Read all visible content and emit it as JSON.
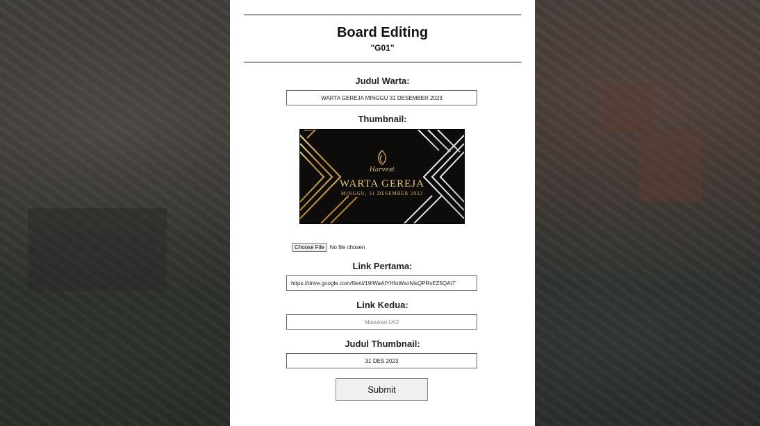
{
  "header": {
    "title": "Board Editing",
    "subtitle": "\"G01\""
  },
  "form": {
    "judul_warta": {
      "label": "Judul Warta:",
      "value": "WARTA GEREJA MINGGU 31 DESEMBER 2023"
    },
    "thumbnail": {
      "label": "Thumbnail:",
      "image": {
        "script_text": "Harvest",
        "headline": "WARTA GEREJA",
        "date_line": "MINGGU, 31 DESEMBER 2023"
      },
      "file_button": "Choose File",
      "file_status": "No file chosen"
    },
    "link_pertama": {
      "label": "Link Pertama:",
      "value": "https://drive.google.com/file/d/19IWaAtYHfoWsoNisQPRvEZ5QAt7'"
    },
    "link_kedua": {
      "label": "Link Kedua:",
      "placeholder": "Masukan Url2",
      "value": ""
    },
    "judul_thumbnail": {
      "label": "Judul Thumbnail:",
      "value": "31 DES 2023"
    },
    "submit_label": "Submit"
  },
  "colors": {
    "gold": "#c9a24a",
    "panel": "#ffffff"
  }
}
